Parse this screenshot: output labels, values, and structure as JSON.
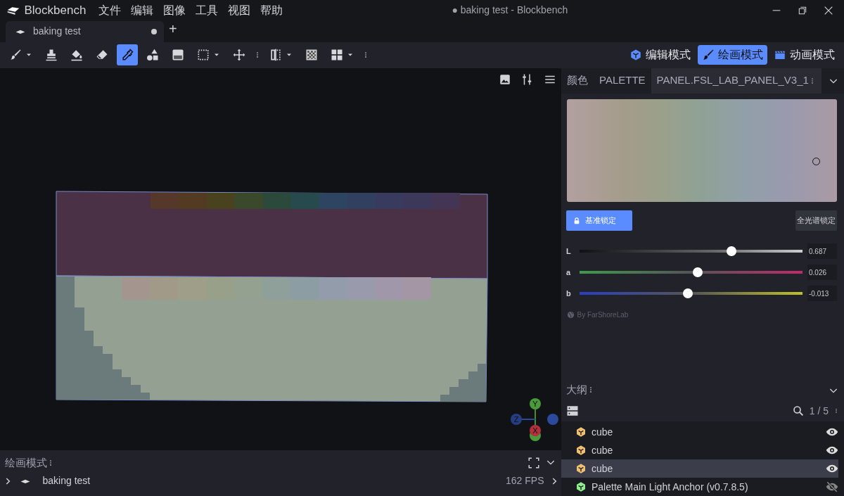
{
  "app": {
    "name": "Blockbench"
  },
  "menu": [
    "文件",
    "编辑",
    "图像",
    "工具",
    "视图",
    "帮助"
  ],
  "window_title": "● baking test - Blockbench",
  "tabs": [
    {
      "label": "baking test",
      "selected": true,
      "unsaved": true
    }
  ],
  "new_tab": "+",
  "tools": [
    {
      "selected": false,
      "dropdown": true
    },
    {
      "selected": false,
      "dropdown": false
    },
    {
      "selected": false,
      "dropdown": false
    },
    {
      "selected": false,
      "dropdown": false
    },
    {
      "selected": true,
      "dropdown": false
    },
    {
      "selected": false,
      "dropdown": false
    },
    {
      "selected": false,
      "dropdown": false
    },
    {
      "selected": false,
      "dropdown": true
    },
    {
      "selected": false,
      "dropdown": false
    },
    {
      "selected": false,
      "dropdown": true
    },
    {
      "selected": false,
      "dropdown": false
    },
    {
      "selected": false,
      "dropdown": true
    }
  ],
  "modes": [
    {
      "label": "编辑模式",
      "selected": false
    },
    {
      "label": "绘画模式",
      "selected": true
    },
    {
      "label": "动画模式",
      "selected": false
    }
  ],
  "gizmo_axes": [
    "Y",
    "Z",
    "X"
  ],
  "bottom_panel": {
    "title": "绘画模式",
    "project": "baking test",
    "fps": "162 FPS"
  },
  "panel_tabs": [
    {
      "label": "颜色",
      "selected": false
    },
    {
      "label": "PALETTE",
      "selected": false
    },
    {
      "label": "PANEL.FSL_LAB_PANEL_V3_1",
      "selected": true
    }
  ],
  "locks": [
    {
      "label": "基准锁定",
      "on": true
    },
    {
      "label": "全光谱锁定",
      "on": false
    }
  ],
  "sliders": [
    {
      "name": "L",
      "level": 0.68,
      "reading": "0.687"
    },
    {
      "name": "a",
      "level": 0.53,
      "reading": "0.026"
    },
    {
      "name": "b",
      "level": 0.485,
      "reading": "-0.013"
    }
  ],
  "credit": "By FarShoreLab",
  "outliner": {
    "title": "大纲",
    "count": "1 / 5",
    "items": [
      {
        "name": "cube",
        "color": "#f0c070",
        "selected": false,
        "visible": true
      },
      {
        "name": "cube",
        "color": "#f0c070",
        "selected": false,
        "visible": true
      },
      {
        "name": "cube",
        "color": "#f0c070",
        "selected": true,
        "visible": true
      },
      {
        "name": "Palette Main Light Anchor (v0.7.8.5)",
        "color": "#8ef08c",
        "selected": false,
        "visible": false
      }
    ]
  }
}
